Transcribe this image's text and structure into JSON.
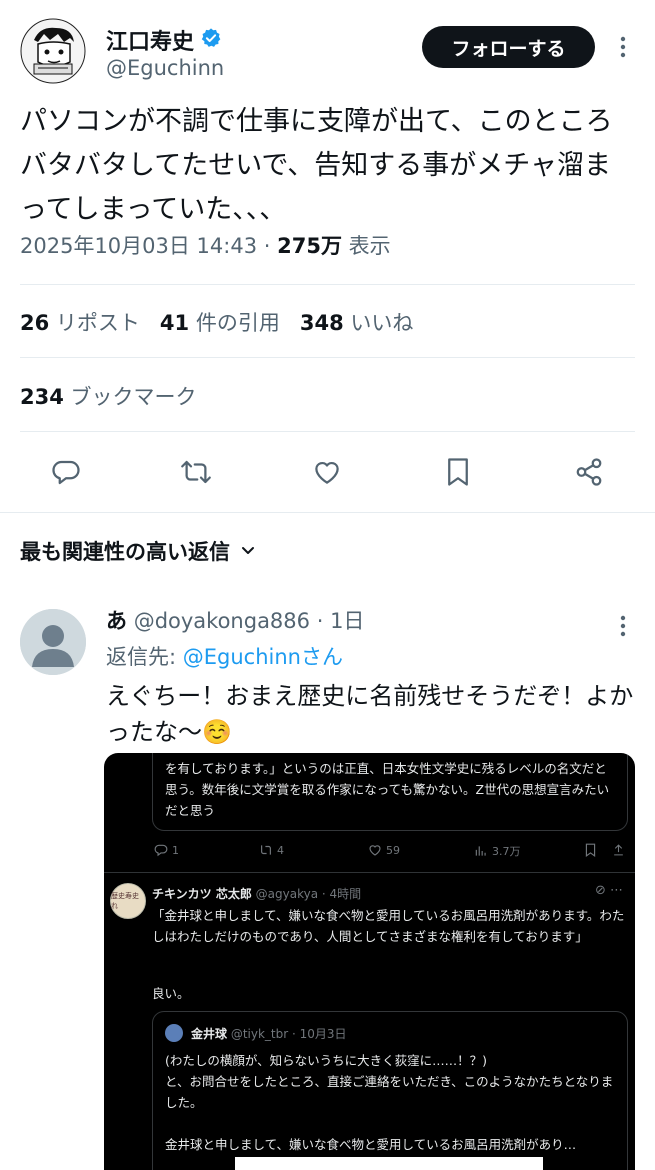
{
  "author": {
    "name": "江口寿史",
    "handle": "@Eguchinn",
    "verified": true,
    "follow_label": "フォローする"
  },
  "tweet": {
    "text": "パソコンが不調で仕事に支障が出て、このところバタバタしてたせいで、告知する事がメチャ溜まってしまっていた、、、",
    "datetime": "2025年10月03日 14:43",
    "views_count": "275万",
    "views_label": "表示"
  },
  "stats": {
    "reposts_count": "26",
    "reposts_label": "リポスト",
    "quotes_count": "41",
    "quotes_label": "件の引用",
    "likes_count": "348",
    "likes_label": "いいね",
    "bookmarks_count": "234",
    "bookmarks_label": "ブックマーク"
  },
  "actions": [
    "reply-icon",
    "retweet-icon",
    "heart-icon",
    "bookmark-icon",
    "share-icon"
  ],
  "replies_sort": {
    "label": "最も関連性の高い返信"
  },
  "reply": {
    "name": "あ",
    "handle": "@doyakonga886",
    "time": "1日",
    "replying_prefix": "返信先:",
    "replying_to": "@Eguchinnさん",
    "text": "えぐちー！おまえ歴史に名前残せそうだぞ！よかったな〜☺️",
    "screenshot": {
      "quote_text": "を有しております。」というのは正直、日本女性文学史に残るレベルの名文だと思う。数年後に文学賞を取る作家になっても驚かない。Z世代の思想宣言みたいだと思う",
      "metrics": {
        "replies": "1",
        "reposts": "4",
        "likes": "59",
        "views": "3.7万"
      },
      "post2": {
        "avatar_text": "歴史寿史れ",
        "name": "チキンカツ 芯太郎",
        "handle": "@agyakya",
        "time": "4時間",
        "text": "「金井球と申しまして、嫌いな食べ物と愛用しているお風呂用洗剤があります。わたしはわたしだけのものであり、人間としてさまざまな権利を有しております」",
        "comment": "良い。",
        "quote": {
          "name": "金井球",
          "handle": "@tiyk_tbr",
          "date": "10月3日",
          "text_1": "(わたしの横顔が、知らないうちに大きく荻窪に……！？)",
          "text_2": "と、お問合せをしたところ、直接ご連絡をいただき、このようなかたちとなりました。",
          "text_3": "金井球と申しまして、嫌いな食べ物と愛用しているお風呂用洗剤があり…"
        }
      }
    }
  },
  "colors": {
    "text": "#0f1419",
    "secondary": "#536471",
    "link": "#1d9bf0",
    "verified": "#1d9bf0",
    "divider": "#e6ecf0"
  }
}
